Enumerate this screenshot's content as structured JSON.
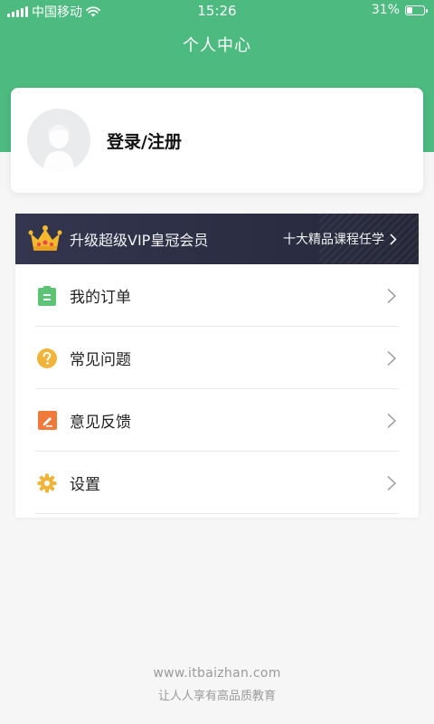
{
  "status_bar": {
    "carrier": "中国移动",
    "time": "15:26",
    "battery": "31%",
    "battery_level": 0.31
  },
  "header": {
    "title": "个人中心"
  },
  "profile": {
    "login_label": "登录/注册",
    "avatar_icon": "default-avatar-icon"
  },
  "vip": {
    "title": "升级超级VIP皇冠会员",
    "link": "十大精品课程任学",
    "icon": "crown-icon"
  },
  "menu": {
    "items": [
      {
        "label": "我的订单",
        "icon": "order-icon",
        "color": "#5dc475"
      },
      {
        "label": "常见问题",
        "icon": "question-icon",
        "color": "#f0b43a"
      },
      {
        "label": "意见反馈",
        "icon": "feedback-icon",
        "color": "#ef7a3a"
      },
      {
        "label": "设置",
        "icon": "gear-icon",
        "color": "#f0b43a"
      }
    ]
  },
  "footer": {
    "site": "www.itbaizhan.com",
    "slogan": "让人人享有高品质教育"
  },
  "colors": {
    "brand": "#4dba7f",
    "vip_banner": "#2f3147"
  }
}
